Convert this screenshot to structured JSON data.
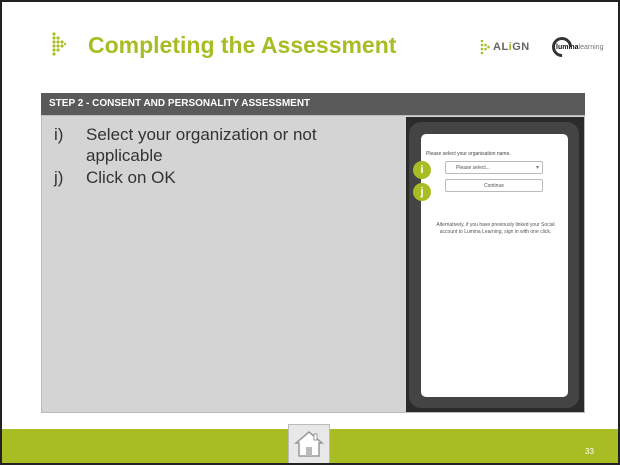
{
  "header": {
    "title": "Completing the Assessment",
    "align_logo": {
      "prefix": "AL",
      "highlight": "i",
      "suffix": "GN"
    },
    "lumina_logo": {
      "bold": "lumina",
      "light": "learning"
    }
  },
  "step_banner": "STEP 2 - CONSENT AND PERSONALITY ASSESSMENT",
  "instructions": [
    {
      "marker": "i)",
      "text": "Select your organization or not applicable"
    },
    {
      "marker": "j)",
      "text": "Click on OK"
    }
  ],
  "phone": {
    "prompt": "Please select your organisation name.",
    "select_placeholder": "Please select...",
    "continue_label": "Continue",
    "alt_text": "Alternatively, if you have previously linked your Social account to Lumina Learning, sign in with one click.",
    "callouts": [
      "i",
      "j"
    ]
  },
  "footer": {
    "page_number": "33"
  },
  "colors": {
    "accent": "#a8bd24",
    "banner": "#5a5a5a",
    "panel": "#d4d4d4",
    "phone_bg": "#2b2b2b"
  },
  "icons": {
    "bullet": "dotted-triangle-icon",
    "home": "home-icon"
  }
}
